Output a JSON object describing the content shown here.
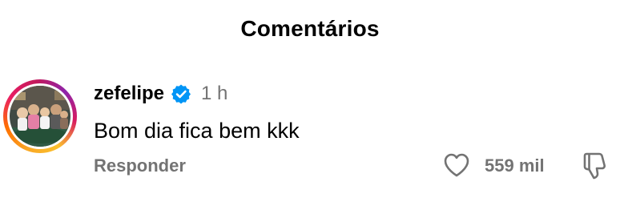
{
  "header": {
    "title": "Comentários"
  },
  "comment": {
    "username": "zefelipe",
    "verified": true,
    "time": "1 h",
    "text": "Bom dia fica bem kkk",
    "reply_label": "Responder",
    "like_count": "559 mil"
  },
  "icons": {
    "verified": "verified-badge-icon",
    "like": "heart-outline-icon",
    "dislike": "thumbs-down-icon"
  },
  "colors": {
    "text": "#000000",
    "muted": "#737373",
    "verified_blue": "#0095f6",
    "story_ring": [
      "#f9a825",
      "#e91e63",
      "#8e24aa"
    ]
  }
}
